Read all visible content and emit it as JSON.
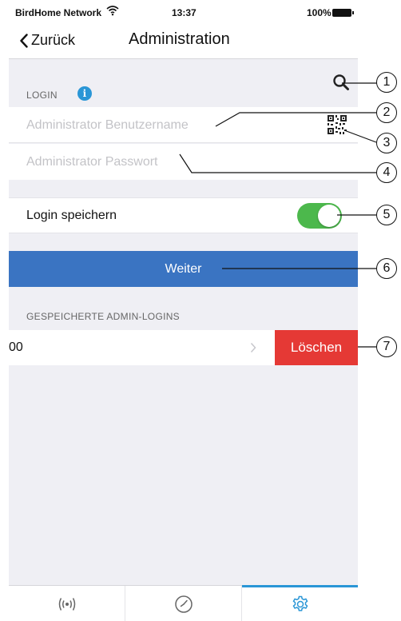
{
  "status_bar": {
    "carrier": "BirdHome Network",
    "time": "13:37",
    "battery": "100%"
  },
  "nav": {
    "back_label": "Zurück",
    "title": "Administration"
  },
  "login_section": {
    "header": "LOGIN",
    "info_glyph": "i",
    "username_placeholder": "Administrator Benutzername",
    "password_placeholder": "Administrator Passwort"
  },
  "save_login": {
    "label": "Login speichern",
    "enabled": true
  },
  "continue_button": "Weiter",
  "saved_logins": {
    "header": "GESPEICHERTE ADMIN-LOGINS",
    "items": [
      {
        "name": "00",
        "delete_label": "Löschen"
      }
    ]
  },
  "tabs": [
    {
      "icon": "broadcast-icon"
    },
    {
      "icon": "clock-icon"
    },
    {
      "icon": "gear-icon",
      "active": true
    }
  ],
  "callouts": [
    "1",
    "2",
    "3",
    "4",
    "5",
    "6",
    "7"
  ],
  "colors": {
    "accent_blue": "#2a96d6",
    "button_blue": "#3a74c2",
    "toggle_green": "#4cb84c",
    "delete_red": "#e53935"
  }
}
